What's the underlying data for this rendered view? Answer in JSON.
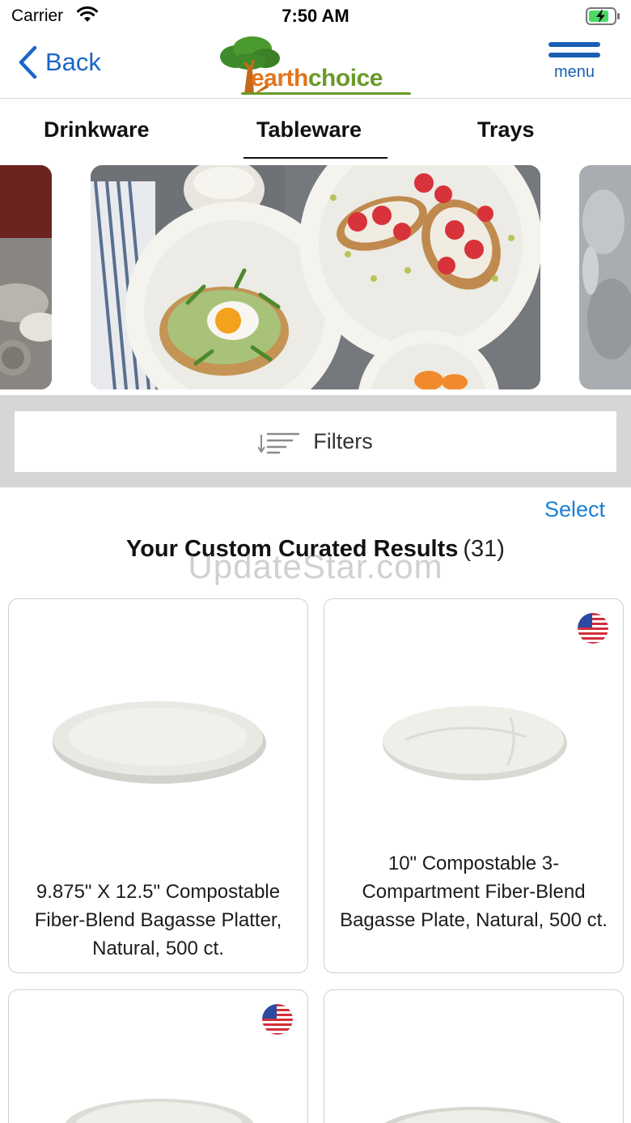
{
  "status_bar": {
    "carrier": "Carrier",
    "time": "7:50 AM"
  },
  "nav": {
    "back_label": "Back",
    "logo_earth": "earth",
    "logo_choice": "choice",
    "menu_label": "menu"
  },
  "tabs": [
    {
      "label": "Drinkware",
      "selected": false
    },
    {
      "label": "Tableware",
      "selected": true
    },
    {
      "label": "Trays",
      "selected": false
    }
  ],
  "filters": {
    "label": "Filters"
  },
  "results": {
    "select_label": "Select",
    "title": "Your Custom Curated Results",
    "count": "(31)",
    "watermark": "UpdateStar.com"
  },
  "products": [
    {
      "title": "9.875\" X 12.5\" Compostable Fiber-Blend Bagasse Platter, Natural, 500 ct.",
      "made_in_usa": false
    },
    {
      "title": "10\" Compostable 3-Compartment Fiber-Blend Bagasse Plate, Natural, 500 ct.",
      "made_in_usa": true
    },
    {
      "title": "",
      "made_in_usa": true
    },
    {
      "title": "",
      "made_in_usa": false
    }
  ],
  "colors": {
    "accent_blue": "#1a66c9",
    "link_blue": "#1a7fd6",
    "logo_orange": "#e3741c",
    "logo_green": "#6a9a2a",
    "filter_band": "#d6d6d6"
  }
}
